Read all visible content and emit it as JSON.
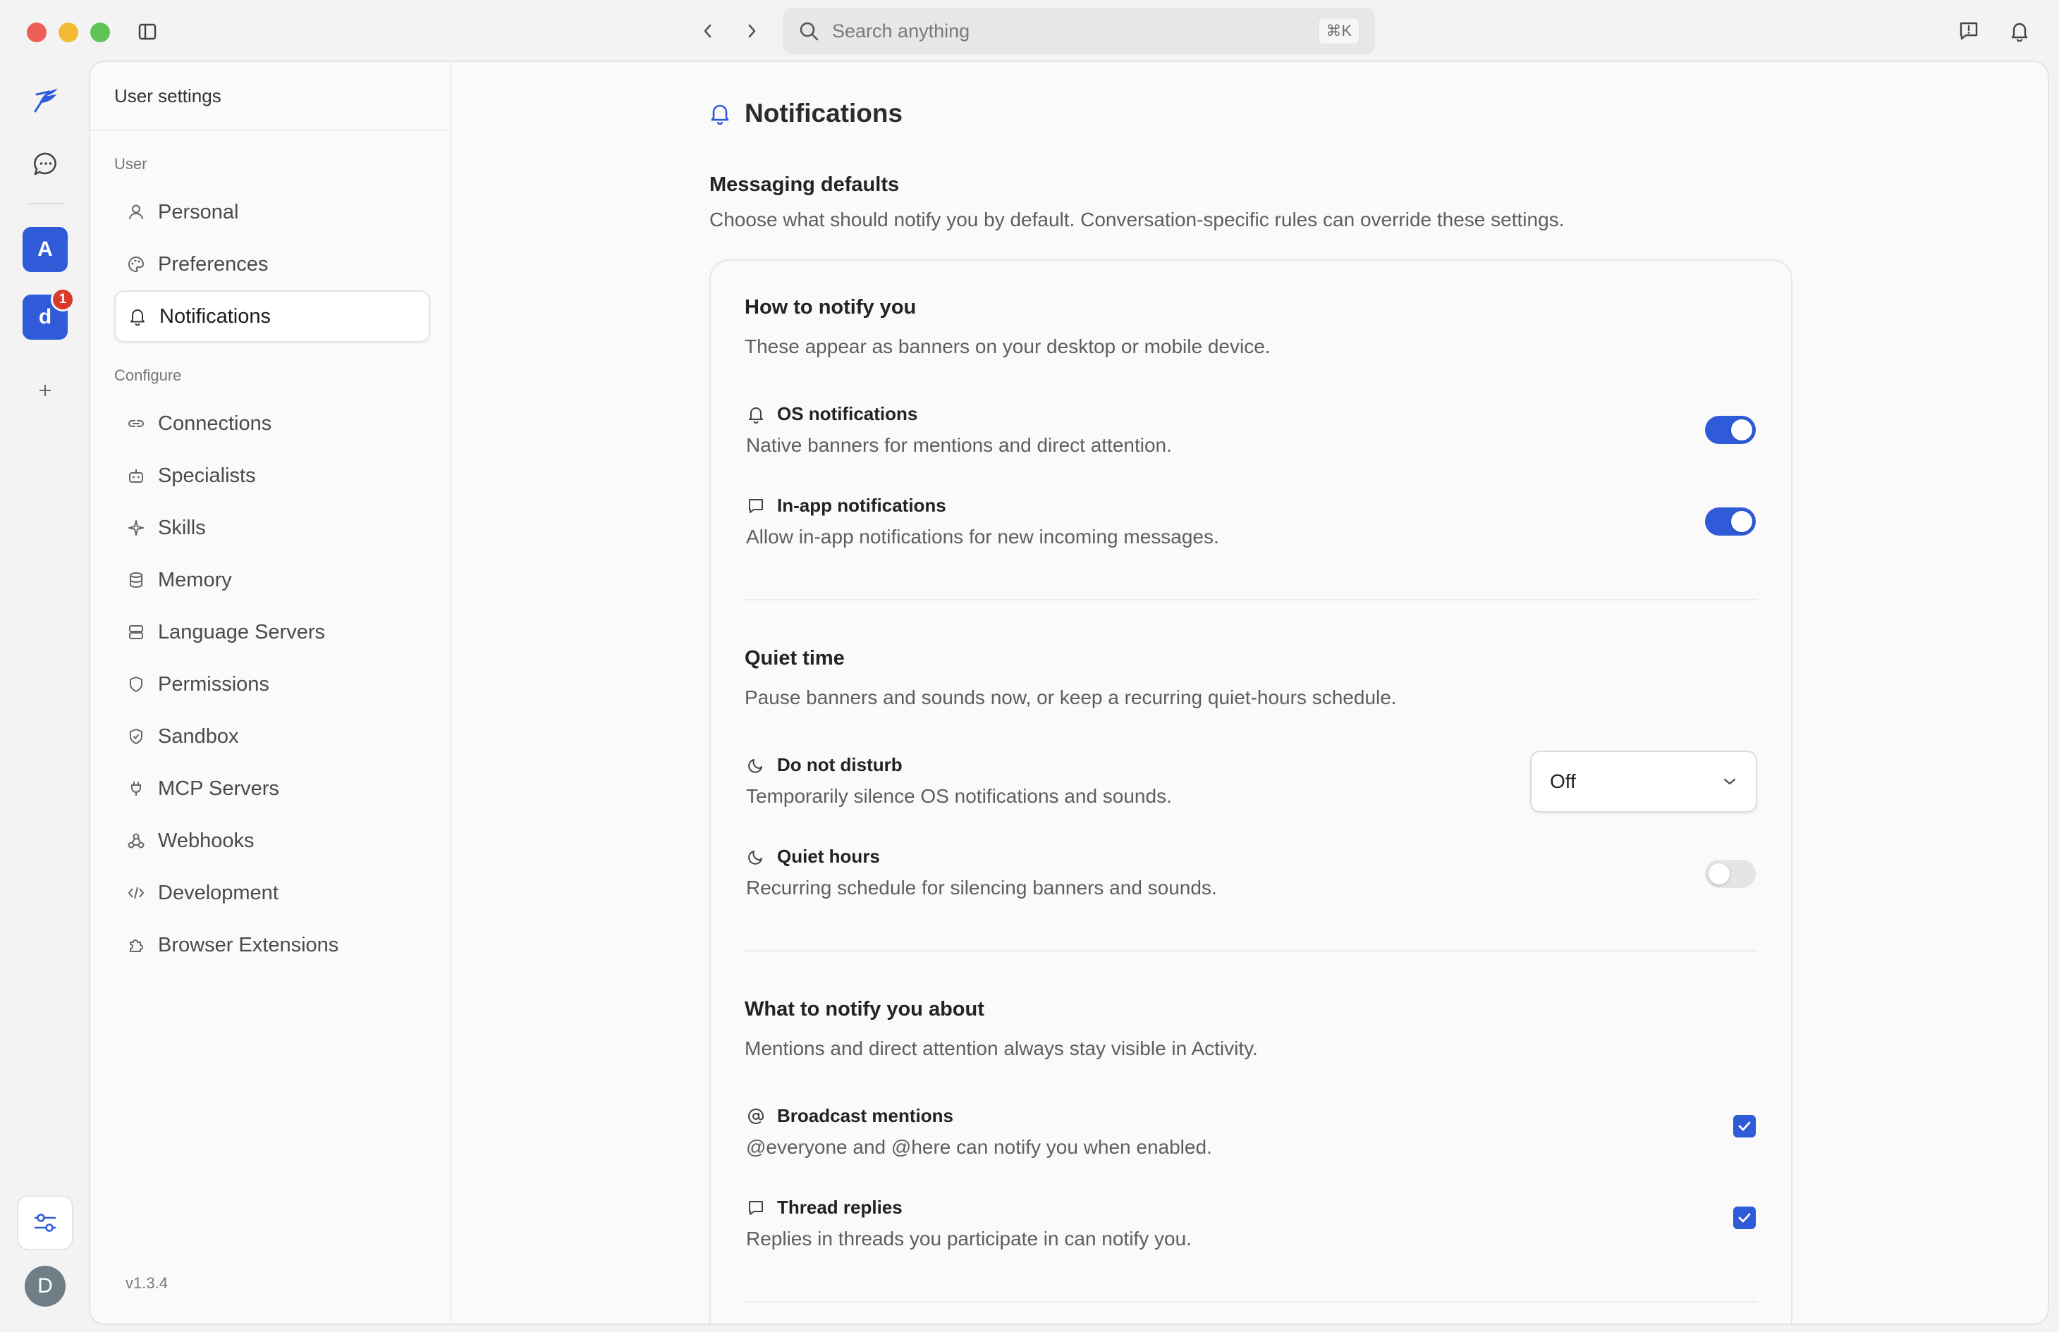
{
  "titlebar": {
    "search_placeholder": "Search anything",
    "search_shortcut": "⌘K"
  },
  "rail": {
    "workspaces": [
      {
        "letter": "A"
      },
      {
        "letter": "d",
        "badge": "1"
      }
    ],
    "avatar": "D"
  },
  "settings_nav": {
    "header": "User settings",
    "section_user": "User",
    "user_items": [
      {
        "label": "Personal",
        "icon": "user-icon"
      },
      {
        "label": "Preferences",
        "icon": "palette-icon"
      },
      {
        "label": "Notifications",
        "icon": "bell-icon",
        "active": true
      }
    ],
    "section_configure": "Configure",
    "configure_items": [
      {
        "label": "Connections",
        "icon": "link-icon"
      },
      {
        "label": "Specialists",
        "icon": "bot-icon"
      },
      {
        "label": "Skills",
        "icon": "sparkles-icon"
      },
      {
        "label": "Memory",
        "icon": "database-icon"
      },
      {
        "label": "Language Servers",
        "icon": "server-icon"
      },
      {
        "label": "Permissions",
        "icon": "shield-icon"
      },
      {
        "label": "Sandbox",
        "icon": "shield-check-icon"
      },
      {
        "label": "MCP Servers",
        "icon": "plug-icon"
      },
      {
        "label": "Webhooks",
        "icon": "webhook-icon"
      },
      {
        "label": "Development",
        "icon": "code-icon"
      },
      {
        "label": "Browser Extensions",
        "icon": "puzzle-icon"
      }
    ],
    "version": "v1.3.4"
  },
  "page": {
    "title": "Notifications",
    "section_title": "Messaging defaults",
    "section_desc": "Choose what should notify you by default. Conversation-specific rules can override these settings.",
    "how": {
      "title": "How to notify you",
      "desc": "These appear as banners on your desktop or mobile device.",
      "os": {
        "title": "OS notifications",
        "desc": "Native banners for mentions and direct attention.",
        "enabled": true
      },
      "inapp": {
        "title": "In-app notifications",
        "desc": "Allow in-app notifications for new incoming messages.",
        "enabled": true
      }
    },
    "quiet": {
      "title": "Quiet time",
      "desc": "Pause banners and sounds now, or keep a recurring quiet-hours schedule.",
      "dnd": {
        "title": "Do not disturb",
        "desc": "Temporarily silence OS notifications and sounds.",
        "value": "Off"
      },
      "hours": {
        "title": "Quiet hours",
        "desc": "Recurring schedule for silencing banners and sounds.",
        "enabled": false
      }
    },
    "what": {
      "title": "What to notify you about",
      "desc": "Mentions and direct attention always stay visible in Activity.",
      "broadcast": {
        "title": "Broadcast mentions",
        "desc": "@everyone and @here can notify you when enabled.",
        "checked": true
      },
      "threads": {
        "title": "Thread replies",
        "desc": "Replies in threads you participate in can notify you.",
        "checked": true
      }
    }
  },
  "colors": {
    "accent": "#2f5bd9",
    "badge": "#d93a2b"
  }
}
